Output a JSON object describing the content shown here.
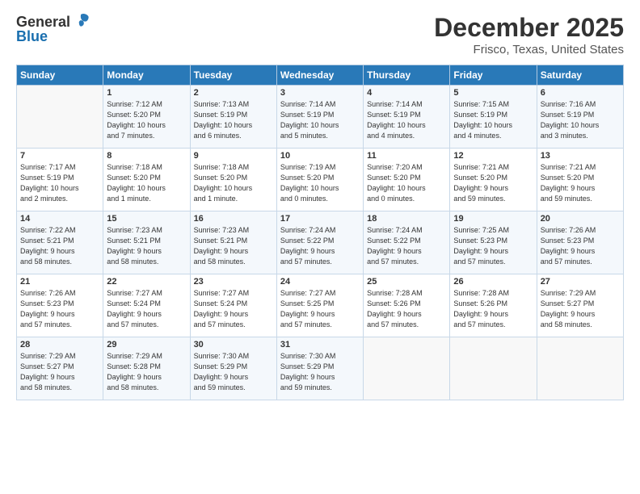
{
  "header": {
    "logo_general": "General",
    "logo_blue": "Blue",
    "title": "December 2025",
    "subtitle": "Frisco, Texas, United States"
  },
  "calendar": {
    "days_of_week": [
      "Sunday",
      "Monday",
      "Tuesday",
      "Wednesday",
      "Thursday",
      "Friday",
      "Saturday"
    ],
    "weeks": [
      [
        {
          "num": "",
          "info": ""
        },
        {
          "num": "1",
          "info": "Sunrise: 7:12 AM\nSunset: 5:20 PM\nDaylight: 10 hours\nand 7 minutes."
        },
        {
          "num": "2",
          "info": "Sunrise: 7:13 AM\nSunset: 5:19 PM\nDaylight: 10 hours\nand 6 minutes."
        },
        {
          "num": "3",
          "info": "Sunrise: 7:14 AM\nSunset: 5:19 PM\nDaylight: 10 hours\nand 5 minutes."
        },
        {
          "num": "4",
          "info": "Sunrise: 7:14 AM\nSunset: 5:19 PM\nDaylight: 10 hours\nand 4 minutes."
        },
        {
          "num": "5",
          "info": "Sunrise: 7:15 AM\nSunset: 5:19 PM\nDaylight: 10 hours\nand 4 minutes."
        },
        {
          "num": "6",
          "info": "Sunrise: 7:16 AM\nSunset: 5:19 PM\nDaylight: 10 hours\nand 3 minutes."
        }
      ],
      [
        {
          "num": "7",
          "info": "Sunrise: 7:17 AM\nSunset: 5:19 PM\nDaylight: 10 hours\nand 2 minutes."
        },
        {
          "num": "8",
          "info": "Sunrise: 7:18 AM\nSunset: 5:20 PM\nDaylight: 10 hours\nand 1 minute."
        },
        {
          "num": "9",
          "info": "Sunrise: 7:18 AM\nSunset: 5:20 PM\nDaylight: 10 hours\nand 1 minute."
        },
        {
          "num": "10",
          "info": "Sunrise: 7:19 AM\nSunset: 5:20 PM\nDaylight: 10 hours\nand 0 minutes."
        },
        {
          "num": "11",
          "info": "Sunrise: 7:20 AM\nSunset: 5:20 PM\nDaylight: 10 hours\nand 0 minutes."
        },
        {
          "num": "12",
          "info": "Sunrise: 7:21 AM\nSunset: 5:20 PM\nDaylight: 9 hours\nand 59 minutes."
        },
        {
          "num": "13",
          "info": "Sunrise: 7:21 AM\nSunset: 5:20 PM\nDaylight: 9 hours\nand 59 minutes."
        }
      ],
      [
        {
          "num": "14",
          "info": "Sunrise: 7:22 AM\nSunset: 5:21 PM\nDaylight: 9 hours\nand 58 minutes."
        },
        {
          "num": "15",
          "info": "Sunrise: 7:23 AM\nSunset: 5:21 PM\nDaylight: 9 hours\nand 58 minutes."
        },
        {
          "num": "16",
          "info": "Sunrise: 7:23 AM\nSunset: 5:21 PM\nDaylight: 9 hours\nand 58 minutes."
        },
        {
          "num": "17",
          "info": "Sunrise: 7:24 AM\nSunset: 5:22 PM\nDaylight: 9 hours\nand 57 minutes."
        },
        {
          "num": "18",
          "info": "Sunrise: 7:24 AM\nSunset: 5:22 PM\nDaylight: 9 hours\nand 57 minutes."
        },
        {
          "num": "19",
          "info": "Sunrise: 7:25 AM\nSunset: 5:23 PM\nDaylight: 9 hours\nand 57 minutes."
        },
        {
          "num": "20",
          "info": "Sunrise: 7:26 AM\nSunset: 5:23 PM\nDaylight: 9 hours\nand 57 minutes."
        }
      ],
      [
        {
          "num": "21",
          "info": "Sunrise: 7:26 AM\nSunset: 5:23 PM\nDaylight: 9 hours\nand 57 minutes."
        },
        {
          "num": "22",
          "info": "Sunrise: 7:27 AM\nSunset: 5:24 PM\nDaylight: 9 hours\nand 57 minutes."
        },
        {
          "num": "23",
          "info": "Sunrise: 7:27 AM\nSunset: 5:24 PM\nDaylight: 9 hours\nand 57 minutes."
        },
        {
          "num": "24",
          "info": "Sunrise: 7:27 AM\nSunset: 5:25 PM\nDaylight: 9 hours\nand 57 minutes."
        },
        {
          "num": "25",
          "info": "Sunrise: 7:28 AM\nSunset: 5:26 PM\nDaylight: 9 hours\nand 57 minutes."
        },
        {
          "num": "26",
          "info": "Sunrise: 7:28 AM\nSunset: 5:26 PM\nDaylight: 9 hours\nand 57 minutes."
        },
        {
          "num": "27",
          "info": "Sunrise: 7:29 AM\nSunset: 5:27 PM\nDaylight: 9 hours\nand 58 minutes."
        }
      ],
      [
        {
          "num": "28",
          "info": "Sunrise: 7:29 AM\nSunset: 5:27 PM\nDaylight: 9 hours\nand 58 minutes."
        },
        {
          "num": "29",
          "info": "Sunrise: 7:29 AM\nSunset: 5:28 PM\nDaylight: 9 hours\nand 58 minutes."
        },
        {
          "num": "30",
          "info": "Sunrise: 7:30 AM\nSunset: 5:29 PM\nDaylight: 9 hours\nand 59 minutes."
        },
        {
          "num": "31",
          "info": "Sunrise: 7:30 AM\nSunset: 5:29 PM\nDaylight: 9 hours\nand 59 minutes."
        },
        {
          "num": "",
          "info": ""
        },
        {
          "num": "",
          "info": ""
        },
        {
          "num": "",
          "info": ""
        }
      ]
    ]
  }
}
